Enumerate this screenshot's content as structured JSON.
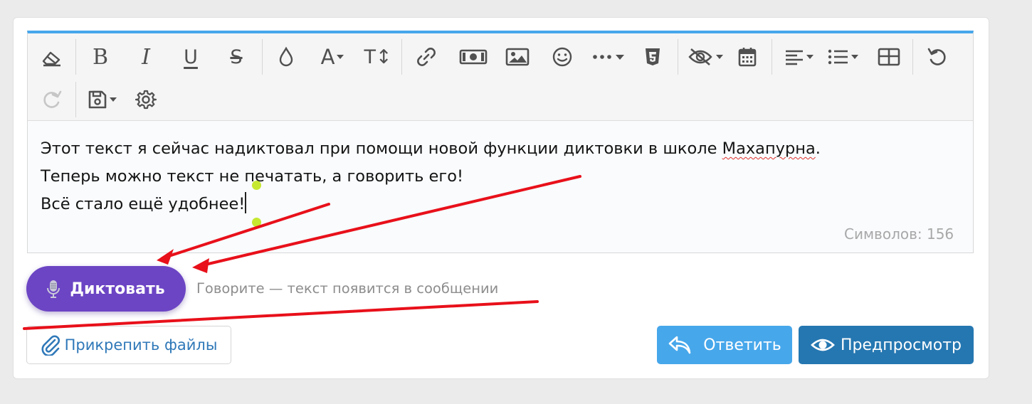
{
  "colors": {
    "accent": "#47a7eb",
    "dictate_button": "#6c45c4",
    "preview_button": "#2577b1",
    "annotation_arrow": "#e8101a"
  },
  "toolbar": {
    "buttons": [
      {
        "icon": "eraser-icon",
        "title": "Remove formatting"
      },
      {
        "icon": "bold-icon",
        "label": "B"
      },
      {
        "icon": "italic-icon",
        "label": "I"
      },
      {
        "icon": "underline-icon",
        "label": "U"
      },
      {
        "icon": "strikethrough-icon",
        "label": "S"
      },
      {
        "icon": "drop-icon"
      },
      {
        "icon": "font-family-icon",
        "label": "A"
      },
      {
        "icon": "font-size-icon",
        "label": "T↕"
      },
      {
        "icon": "link-icon"
      },
      {
        "icon": "money-icon"
      },
      {
        "icon": "image-icon"
      },
      {
        "icon": "smile-icon"
      },
      {
        "icon": "more-icon"
      },
      {
        "icon": "html5-icon"
      },
      {
        "icon": "hide-icon"
      },
      {
        "icon": "calendar-icon"
      },
      {
        "icon": "align-icon"
      },
      {
        "icon": "list-icon"
      },
      {
        "icon": "table-icon"
      },
      {
        "icon": "undo-icon"
      },
      {
        "icon": "redo-icon"
      },
      {
        "icon": "save-draft-icon"
      },
      {
        "icon": "settings-icon"
      }
    ]
  },
  "editor": {
    "line1_before": "Этот текст я сейчас надиктовал при помощи новой функции диктовки в школе ",
    "line1_typo": "Махапурна",
    "line1_after": ".",
    "line2": "Теперь можно текст не печатать, а говорить его!",
    "line3": "Всё стало ещё удобнее!",
    "char_counter": "Символов: 156"
  },
  "dictation": {
    "button_label": "Диктовать",
    "hint": "Говорите — текст появится в сообщении"
  },
  "actions": {
    "attach_label": "Прикрепить файлы",
    "reply_label": "Ответить",
    "preview_label": "Предпросмотр"
  }
}
